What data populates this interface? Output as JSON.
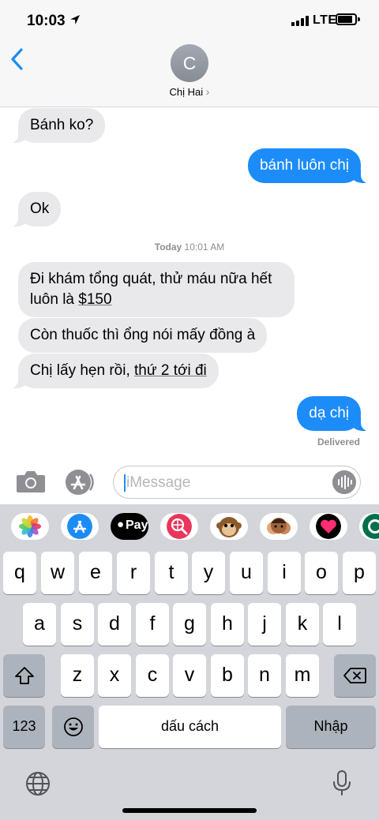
{
  "status_bar": {
    "time": "10:03",
    "network": "LTE"
  },
  "header": {
    "avatar_initial": "C",
    "contact_name": "Chị Hai",
    "contact_chevron": "›"
  },
  "messages": [
    {
      "dir": "in",
      "text": "Bánh ko?"
    },
    {
      "dir": "out",
      "text": "bánh luôn chị"
    },
    {
      "dir": "in",
      "text": "Ok"
    },
    {
      "dir": "in",
      "line1": "Đi khám tổng quát, thử máu nữa hết",
      "line2_pre": "luôn là ",
      "line2_link": "$150"
    },
    {
      "dir": "in",
      "text": "Còn thuốc thì ổng nói mấy đồng à"
    },
    {
      "dir": "in",
      "pre": "Chị lấy hẹn rồi, ",
      "link": "thứ 2 tới đi"
    },
    {
      "dir": "out",
      "text": "dạ chị"
    }
  ],
  "timestamp": {
    "day": "Today",
    "time": "10:01 AM"
  },
  "delivered": "Delivered",
  "input": {
    "placeholder": "iMessage"
  },
  "app_drawer": {
    "apps": [
      {
        "name": "photos-app",
        "color": "#ffffff"
      },
      {
        "name": "appstore-app",
        "color": "#1a8cf6"
      },
      {
        "name": "apple-pay-app",
        "label": "Pay",
        "color": "#000000"
      },
      {
        "name": "images-search-app",
        "color": "#e8365c"
      },
      {
        "name": "animoji-app",
        "color": "#ffffff"
      },
      {
        "name": "memoji-app",
        "color": "#ffffff"
      },
      {
        "name": "digital-touch-app",
        "color": "#000000"
      },
      {
        "name": "starbucks-app",
        "color": "#00704a"
      }
    ]
  },
  "keyboard": {
    "row1": [
      "q",
      "w",
      "e",
      "r",
      "t",
      "y",
      "u",
      "i",
      "o",
      "p"
    ],
    "row2": [
      "a",
      "s",
      "d",
      "f",
      "g",
      "h",
      "j",
      "k",
      "l"
    ],
    "row3": [
      "z",
      "x",
      "c",
      "v",
      "b",
      "n",
      "m"
    ],
    "numbers_key": "123",
    "space_key": "dấu cách",
    "return_key": "Nhập"
  },
  "colors": {
    "accent": "#1c8cf9",
    "incoming_bubble": "#e9e9eb",
    "keyboard_bg": "#d3d5da"
  }
}
